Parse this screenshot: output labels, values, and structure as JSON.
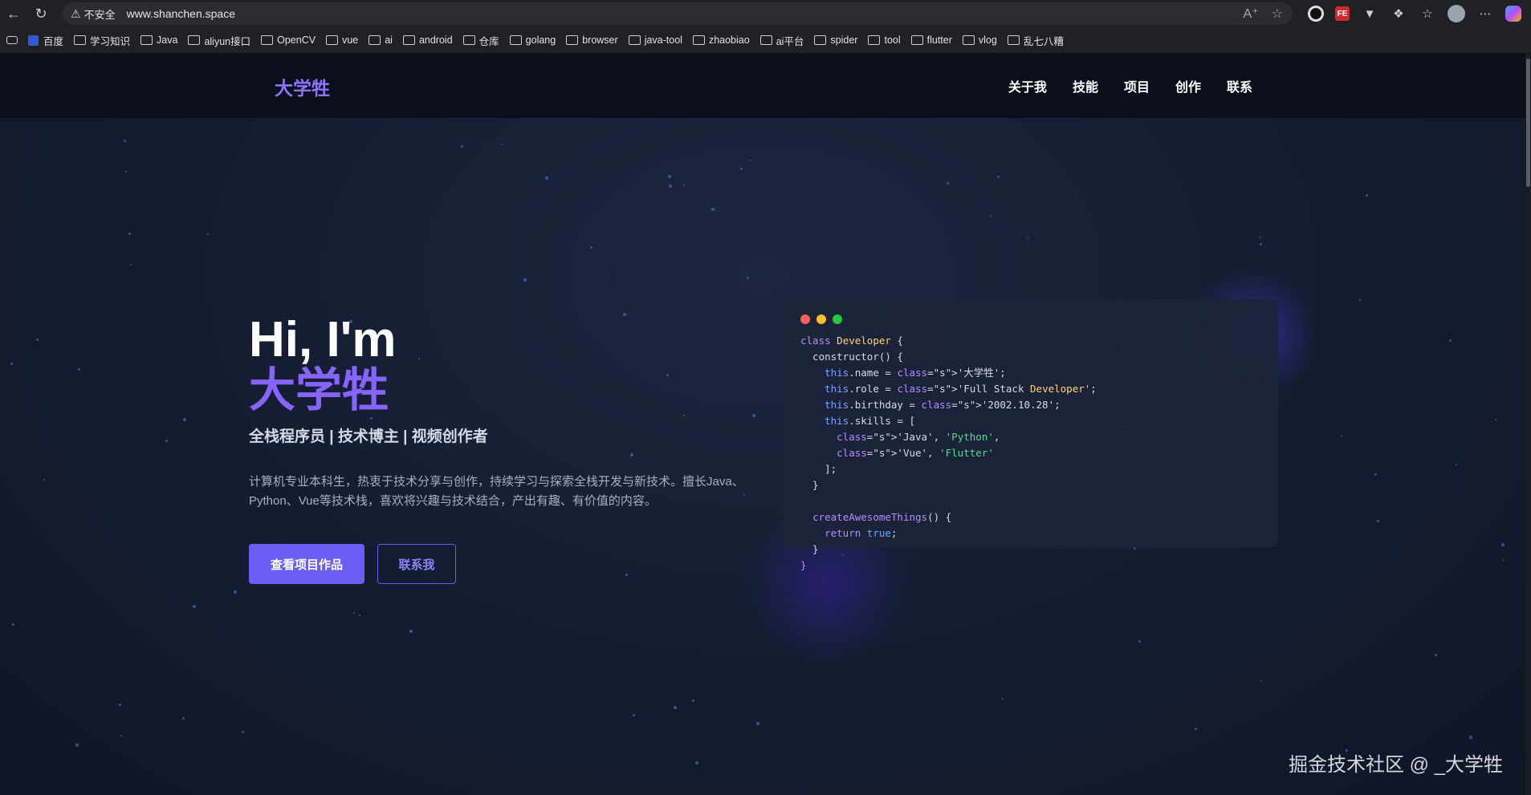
{
  "browser": {
    "insecure_label": "不安全",
    "url": "www.shanchen.space",
    "bookmarks": [
      "百度",
      "学习知识",
      "Java",
      "aliyun接口",
      "OpenCV",
      "vue",
      "ai",
      "android",
      "仓库",
      "golang",
      "browser",
      "java-tool",
      "zhaobiao",
      "ai平台",
      "spider",
      "tool",
      "flutter",
      "vlog",
      "乱七八糟"
    ]
  },
  "site": {
    "brand": "大学牲",
    "menu": [
      "关于我",
      "技能",
      "项目",
      "创作",
      "联系"
    ],
    "hero": {
      "title": "Hi, I'm",
      "name": "大学牲",
      "subtitle": "全栈程序员 | 技术博主 | 视频创作者",
      "description": "计算机专业本科生，热衷于技术分享与创作，持续学习与探索全栈开发与新技术。擅长Java、Python、Vue等技术栈，喜欢将兴趣与技术结合，产出有趣、有价值的内容。",
      "primary_button": "查看项目作品",
      "secondary_button": "联系我"
    },
    "code_window": {
      "dot_colors": [
        "#ff5f56",
        "#ffbd2e",
        "#27c93f"
      ],
      "lines": [
        "class Developer {",
        "  constructor() {",
        "    this.name = '大学牲';",
        "    this.role = 'Full Stack Developer';",
        "    this.birthday = '2002.10.28';",
        "    this.skills = [",
        "      'Java', 'Python',",
        "      'Vue', 'Flutter'",
        "    ];",
        "  }",
        "",
        "  createAwesomeThings() {",
        "    return true;",
        "  }",
        "}"
      ]
    }
  },
  "watermark": "掘金技术社区 @ _大学牲",
  "colors": {
    "accent": "#6a5cf5",
    "name_purple": "#8564ff",
    "page_bg": "#141d31",
    "nav_bg": "#0b0f19"
  }
}
